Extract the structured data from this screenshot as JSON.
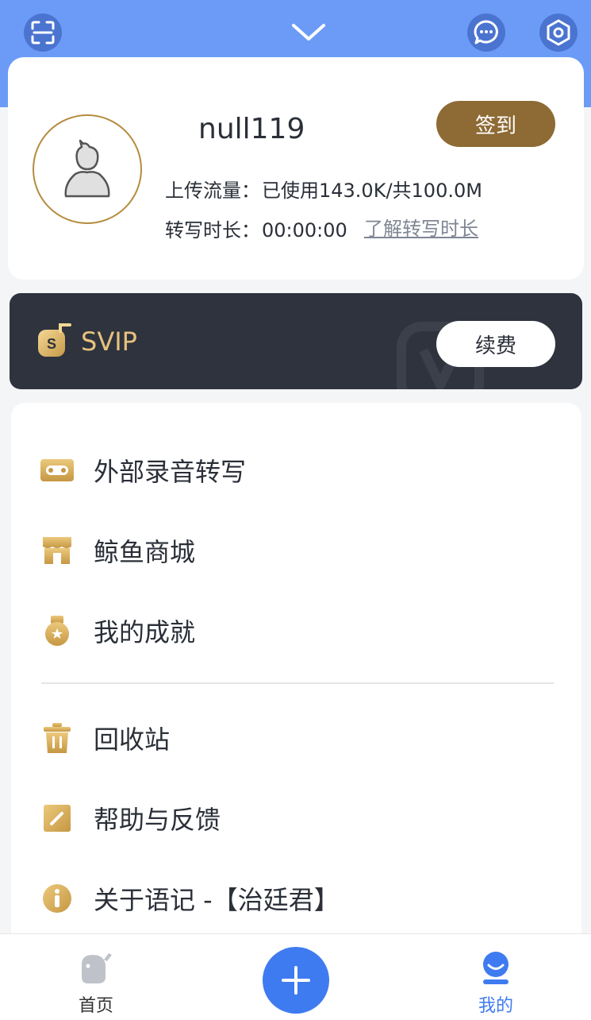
{
  "header": {
    "scan_icon": "scan-icon",
    "expand_icon": "chevron-down-icon",
    "message_icon": "chat-bubble-icon",
    "settings_icon": "hexagon-settings-icon",
    "band_color": "#6b9bf7"
  },
  "profile": {
    "username": "null119",
    "signin_label": "签到",
    "upload_label": "上传流量：",
    "upload_value": "已使用143.0K/共100.0M",
    "transcribe_label": "转写时长：",
    "transcribe_value": "00:00:00",
    "learn_link": "了解转写时长",
    "accent_color": "#8e6a34"
  },
  "svip": {
    "label": "SVIP",
    "renew_label": "续费",
    "badge_letter": "S"
  },
  "menu": {
    "items": [
      {
        "label": "外部录音转写",
        "icon": "cassette-icon"
      },
      {
        "label": "鲸鱼商城",
        "icon": "store-icon"
      },
      {
        "label": "我的成就",
        "icon": "medal-icon"
      },
      {
        "label": "回收站",
        "icon": "trash-icon"
      },
      {
        "label": "帮助与反馈",
        "icon": "edit-icon"
      },
      {
        "label": "关于语记 -【治廷君】",
        "icon": "info-icon"
      }
    ]
  },
  "bottom_nav": {
    "tabs": [
      {
        "label": "首页",
        "icon": "whale-icon"
      },
      {
        "label": "我的",
        "icon": "user-icon",
        "active": true
      }
    ],
    "add_icon": "plus-icon",
    "active_color": "#3f7bf0"
  }
}
